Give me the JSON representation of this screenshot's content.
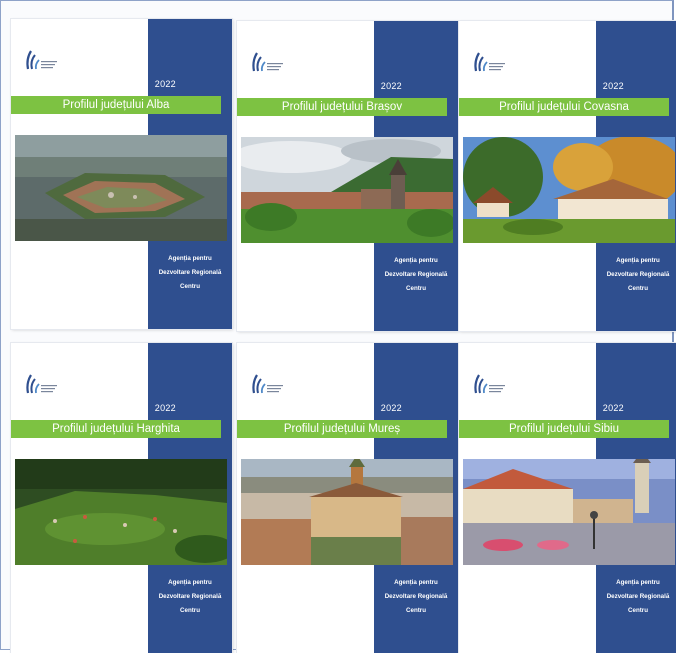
{
  "covers": [
    {
      "year": "2022",
      "title": "Profilul județului Alba",
      "agency": [
        "Agenția pentru",
        "Dezvoltare Regională",
        "Centru"
      ],
      "photo": "alba-fortress-aerial"
    },
    {
      "year": "2022",
      "title": "Profilul județului Brașov",
      "agency": [
        "Agenția pentru",
        "Dezvoltare Regională",
        "Centru"
      ],
      "photo": "brasov-black-church"
    },
    {
      "year": "2022",
      "title": "Profilul județului Covasna",
      "agency": [
        "Agenția pentru",
        "Dezvoltare Regională",
        "Centru"
      ],
      "photo": "covasna-autumn-manor"
    },
    {
      "year": "2022",
      "title": "Profilul județului Harghita",
      "agency": [
        "Agenția pentru",
        "Dezvoltare Regională",
        "Centru"
      ],
      "photo": "harghita-forest-village"
    },
    {
      "year": "2022",
      "title": "Profilul județului Mureș",
      "agency": [
        "Agenția pentru",
        "Dezvoltare Regională",
        "Centru"
      ],
      "photo": "mures-palace-of-culture"
    },
    {
      "year": "2022",
      "title": "Profilul județului Sibiu",
      "agency": [
        "Agenția pentru",
        "Dezvoltare Regională",
        "Centru"
      ],
      "photo": "sibiu-square-dusk"
    }
  ],
  "colors": {
    "band": "#2f4f8f",
    "title_bar": "#7dc242",
    "logo": "#2f4f8f"
  },
  "icons": {
    "logo": "adr-centru-logo-icon"
  }
}
